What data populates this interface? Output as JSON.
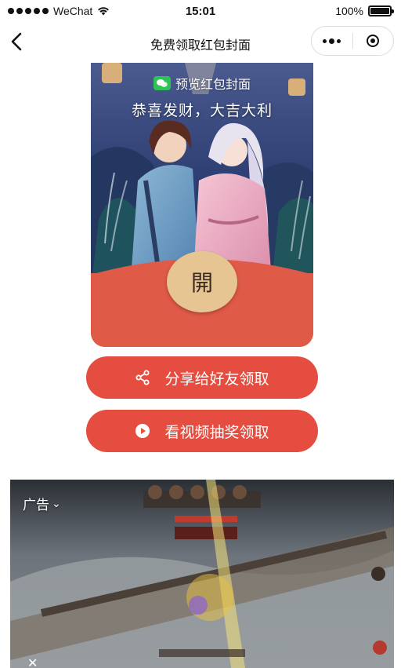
{
  "status_bar": {
    "carrier": "WeChat",
    "time": "15:01",
    "battery": "100%"
  },
  "nav": {
    "title": "免费领取红包封面",
    "back_icon": "chevron-left-icon",
    "more_icon": "more-dots-icon",
    "close_icon": "target-close-icon"
  },
  "cover": {
    "badge_text": "预览红包封面",
    "greeting": "恭喜发财，大吉大利",
    "open_label": "開",
    "accent_color": "#e05a48",
    "open_color": "#e7c593"
  },
  "actions": {
    "share_label": "分享给好友领取",
    "share_icon": "share-icon",
    "video_label": "看视频抽奖领取",
    "video_icon": "play-circle-icon",
    "button_color": "#e44d3f"
  },
  "ad": {
    "label": "广告",
    "chevron": "⌄",
    "close": "✕"
  }
}
